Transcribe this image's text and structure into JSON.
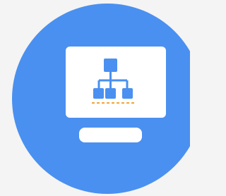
{
  "icon": {
    "name": "network-monitor-icon",
    "colors": {
      "page_background": "#f4f4f4",
      "circle": "#4a90f0",
      "monitor": "#ffffff",
      "nodes": "#4a90f0",
      "node_accent": "#f2a33a"
    }
  }
}
